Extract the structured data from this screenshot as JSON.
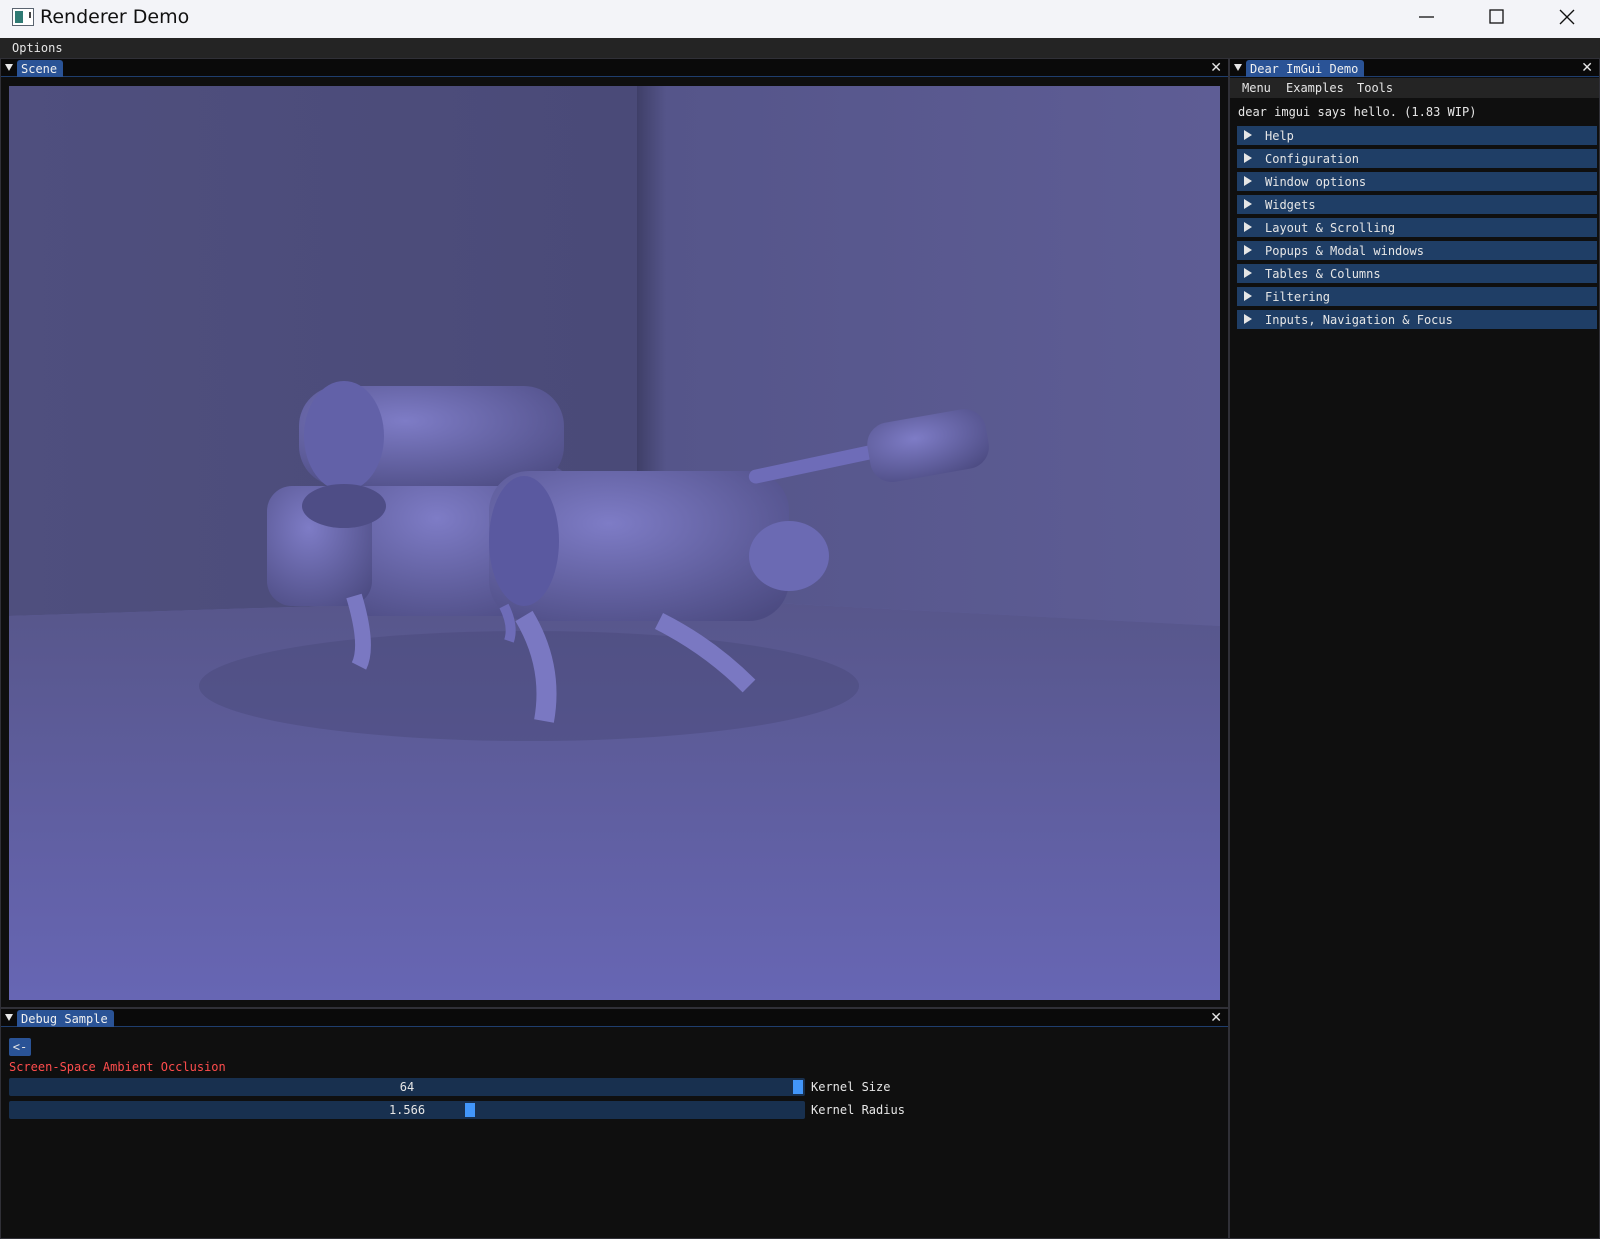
{
  "app": {
    "title": "Renderer Demo"
  },
  "menubar": {
    "options_label": "Options"
  },
  "scene": {
    "tab_label": "Scene",
    "close_glyph": "✕"
  },
  "debug": {
    "tab_label": "Debug Sample",
    "close_glyph": "✕",
    "back_label": "<-",
    "section_label": "Screen-Space Ambient Occlusion",
    "section_color": "#ff4d4d",
    "sliders": [
      {
        "label": "Kernel Size",
        "value": "64",
        "fraction": 1.0
      },
      {
        "label": "Kernel Radius",
        "value": "1.566",
        "fraction": 0.58
      }
    ]
  },
  "demo": {
    "tab_label": "Dear ImGui Demo",
    "close_glyph": "✕",
    "menu": [
      "Menu",
      "Examples",
      "Tools"
    ],
    "hello": "dear imgui says hello. (1.83 WIP)",
    "headers": [
      "Help",
      "Configuration",
      "Window options",
      "Widgets",
      "Layout & Scrolling",
      "Popups & Modal windows",
      "Tables & Columns",
      "Filtering",
      "Inputs, Navigation & Focus"
    ]
  },
  "colors": {
    "accent": "#2a5396",
    "header": "#1f3e66",
    "grab": "#4296fa",
    "scene_tint": "#6563b0"
  },
  "icons": [
    "app-icon",
    "minimize-icon",
    "maximize-icon",
    "close-icon",
    "collapse-arrow-icon",
    "tree-arrow-icon"
  ]
}
